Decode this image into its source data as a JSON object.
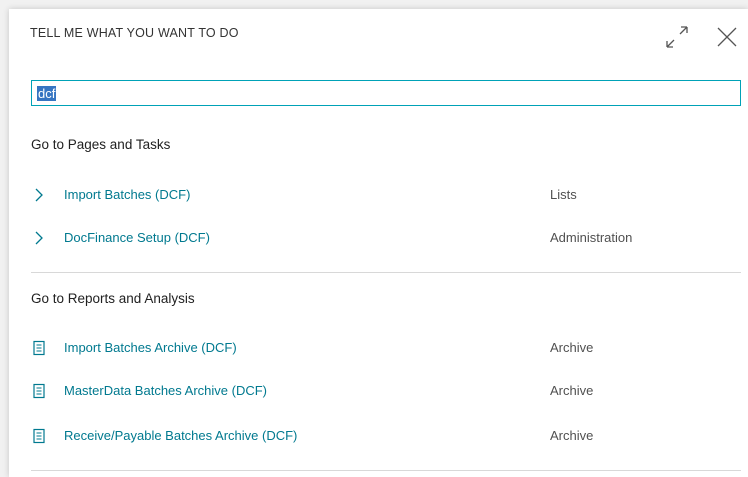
{
  "dialog": {
    "title": "TELL ME WHAT YOU WANT TO DO",
    "expand_icon": "expand-icon",
    "close_icon": "close-icon"
  },
  "search": {
    "value": "dcf",
    "placeholder": ""
  },
  "sections": [
    {
      "title": "Go to Pages and Tasks",
      "items": [
        {
          "label": "Import Batches (DCF)",
          "category": "Lists",
          "icon": "chevron-right-icon"
        },
        {
          "label": "DocFinance Setup (DCF)",
          "category": "Administration",
          "icon": "chevron-right-icon"
        }
      ]
    },
    {
      "title": "Go to Reports and Analysis",
      "items": [
        {
          "label": "Import Batches Archive (DCF)",
          "category": "Archive",
          "icon": "report-icon"
        },
        {
          "label": "MasterData Batches Archive (DCF)",
          "category": "Archive",
          "icon": "report-icon"
        },
        {
          "label": "Receive/Payable Batches Archive (DCF)",
          "category": "Archive",
          "icon": "report-icon"
        }
      ]
    }
  ],
  "colors": {
    "accent": "#00a2b7",
    "link": "#00798f",
    "selection": "#3675c2"
  }
}
